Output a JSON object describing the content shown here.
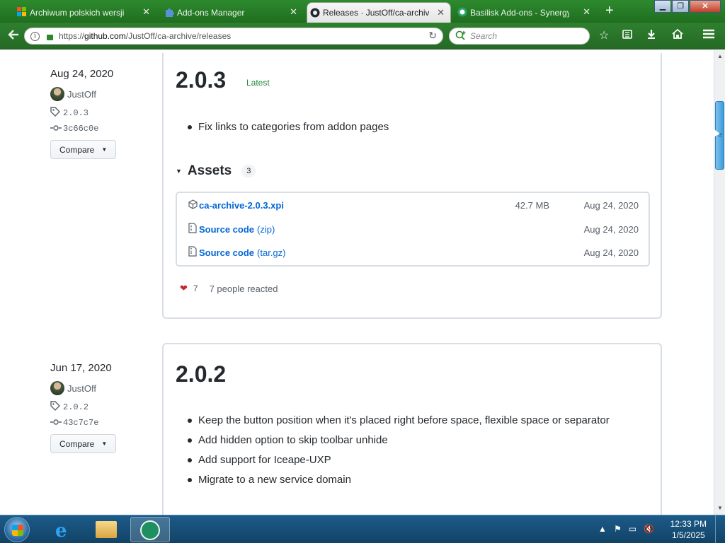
{
  "browser": {
    "tabs": [
      {
        "label": "Archiwum polskich wersji",
        "icon": "windows-logo-icon"
      },
      {
        "label": "Add-ons Manager",
        "icon": "puzzle-icon"
      },
      {
        "label": "Releases · JustOff/ca-archive",
        "icon": "github-icon",
        "active": true
      },
      {
        "label": "Basilisk Add-ons - Synergy",
        "icon": "basilisk-icon"
      }
    ],
    "url_prefix": "https://",
    "url_domain": "github.com",
    "url_path": "/JustOff/ca-archive/releases",
    "search_placeholder": "Search"
  },
  "releases": [
    {
      "date": "Aug 24, 2020",
      "author": "JustOff",
      "tag": "2.0.3",
      "commit": "3c66c0e",
      "compare_label": "Compare",
      "version": "2.0.3",
      "badge": "Latest",
      "notes": [
        "Fix links to categories from addon pages"
      ],
      "assets_title": "Assets",
      "assets_count": "3",
      "assets": [
        {
          "name": "ca-archive-2.0.3.xpi",
          "ext": "",
          "size": "42.7 MB",
          "date": "Aug 24, 2020"
        },
        {
          "name": "Source code",
          "ext": "(zip)",
          "size": "",
          "date": "Aug 24, 2020"
        },
        {
          "name": "Source code",
          "ext": "(tar.gz)",
          "size": "",
          "date": "Aug 24, 2020"
        }
      ],
      "reaction_count": "7",
      "reaction_text": "7 people reacted"
    },
    {
      "date": "Jun 17, 2020",
      "author": "JustOff",
      "tag": "2.0.2",
      "commit": "43c7c7e",
      "compare_label": "Compare",
      "version": "2.0.2",
      "notes": [
        "Keep the button position when it's placed right before space, flexible space or separator",
        "Add hidden option to skip toolbar unhide",
        "Add support for Iceape-UXP",
        "Migrate to a new service domain"
      ]
    }
  ],
  "taskbar": {
    "time": "12:33 PM",
    "date": "1/5/2025"
  }
}
